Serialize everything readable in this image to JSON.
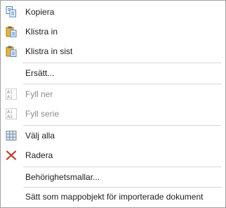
{
  "menu": {
    "items": [
      {
        "label": "Kopiera",
        "icon": "copy-icon"
      },
      {
        "label": "Klistra in",
        "icon": "paste-icon"
      },
      {
        "label": "Klistra in sist",
        "icon": "paste-last-icon"
      },
      {
        "label": "Ersätt...",
        "icon": ""
      },
      {
        "label": "Fyll ner",
        "icon": "fill-down-icon",
        "disabled": true
      },
      {
        "label": "Fyll serie",
        "icon": "fill-series-icon",
        "disabled": true
      },
      {
        "label": "Välj alla",
        "icon": "select-all-icon"
      },
      {
        "label": "Radera",
        "icon": "delete-icon"
      },
      {
        "label": "Behörighetsmallar...",
        "icon": ""
      },
      {
        "label": "Sätt som mappobjekt för importerade dokument",
        "icon": ""
      }
    ],
    "colors": {
      "text": "#1e1e1e",
      "disabled_text": "#8a8a8a",
      "delete_red": "#c0392b",
      "clipboard_yellow": "#e8b43a",
      "border": "#a0a0a0",
      "separator": "#d6d6d6"
    }
  }
}
